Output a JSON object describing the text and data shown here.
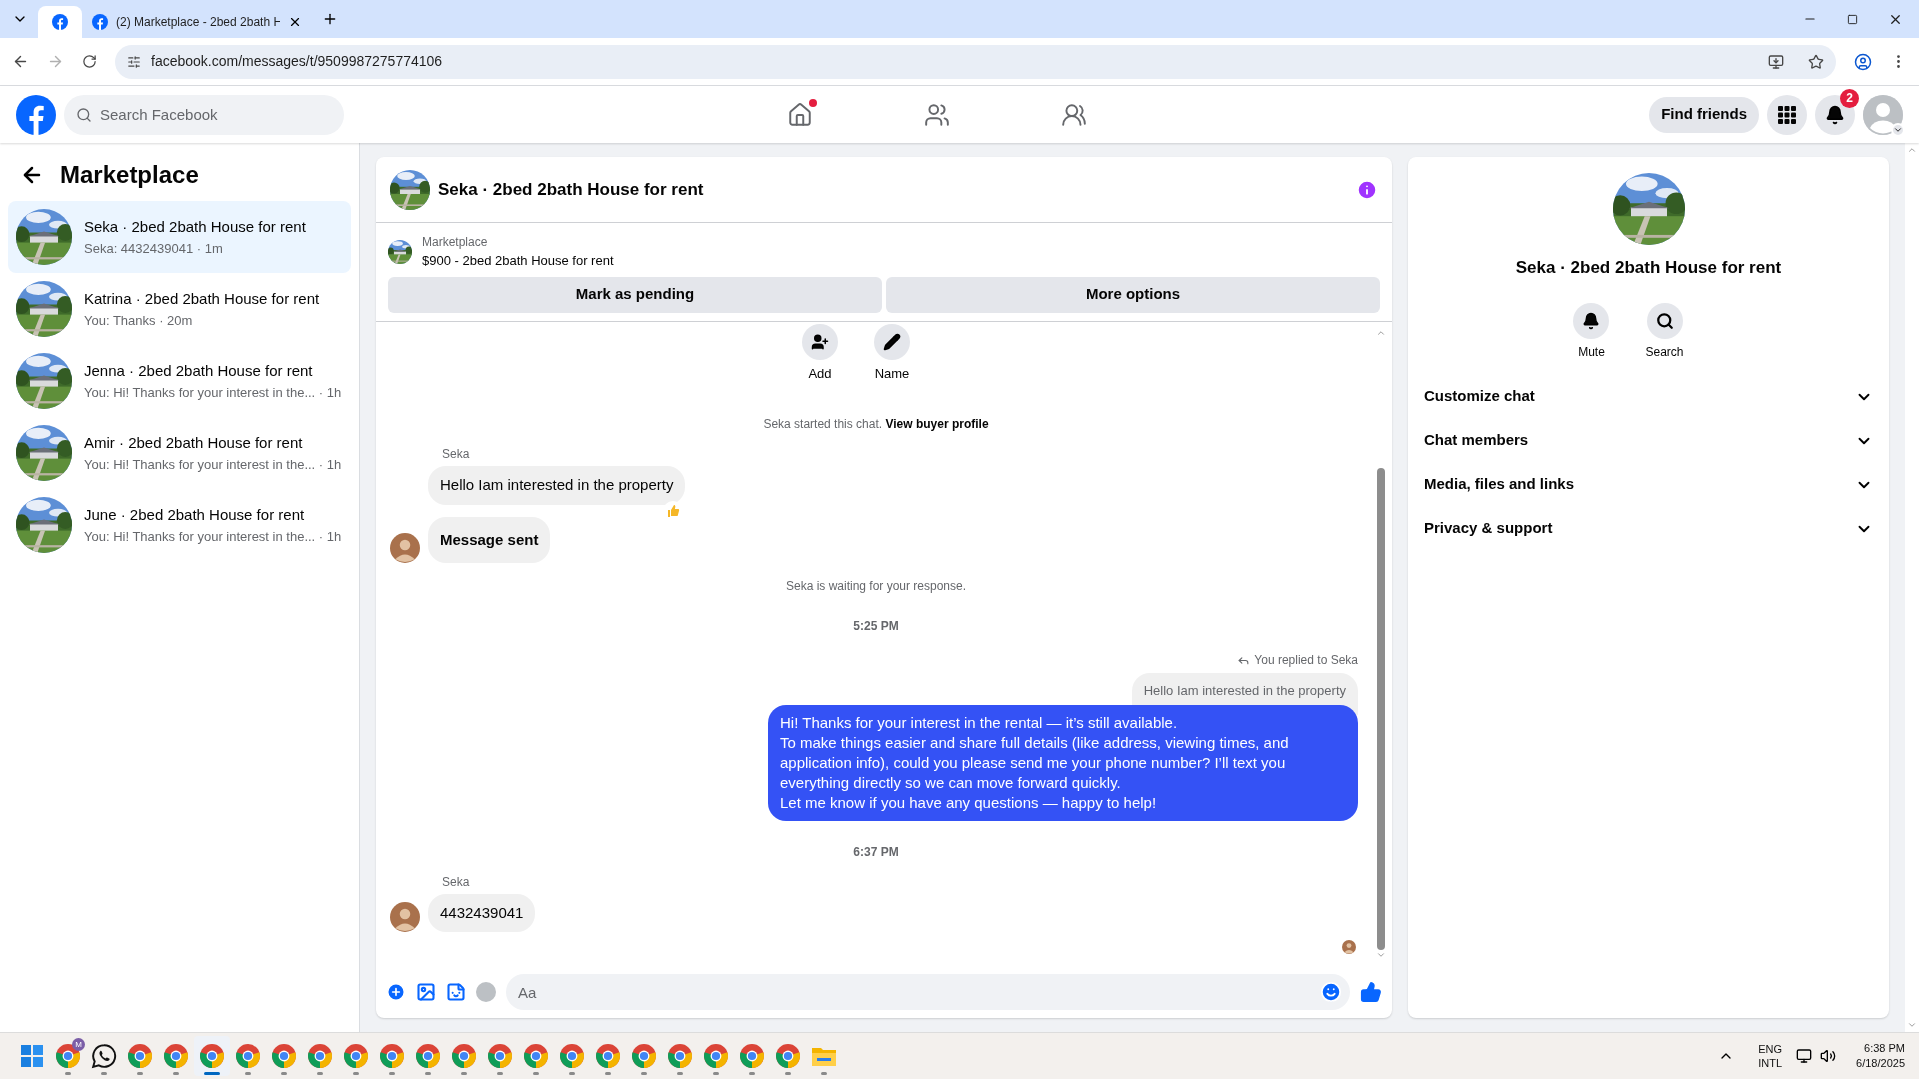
{
  "browser": {
    "tabs": [
      {
        "kind": "pinned",
        "selected": true
      },
      {
        "kind": "page",
        "title": "(2) Marketplace - 2bed 2bath H",
        "selected": false
      }
    ],
    "url": "facebook.com/messages/t/9509987275774106"
  },
  "header": {
    "search": {
      "placeholder": "Search Facebook"
    },
    "nav": [
      {
        "kind": "home",
        "dot": true
      },
      {
        "kind": "friends",
        "dot": false
      },
      {
        "kind": "groups",
        "dot": false
      }
    ],
    "find_friends": "Find friends",
    "notifications_badge": "2"
  },
  "sidebar": {
    "title": "Marketplace",
    "conversations": [
      {
        "title": "Seka · 2bed 2bath House for rent",
        "preview": "Seka: 4432439041 · 1m",
        "selected": true
      },
      {
        "title": "Katrina · 2bed 2bath House for rent",
        "preview": "You: Thanks · 20m",
        "selected": false
      },
      {
        "title": "Jenna · 2bed 2bath House for rent",
        "preview": "You: Hi! Thanks for your interest in the... · 1h",
        "selected": false
      },
      {
        "title": "Amir · 2bed 2bath House for rent",
        "preview": "You: Hi! Thanks for your interest in the... · 1h",
        "selected": false
      },
      {
        "title": "June · 2bed 2bath House for rent",
        "preview": "You: Hi! Thanks for your interest in the... · 1h",
        "selected": false
      }
    ]
  },
  "chat": {
    "title": "Seka · 2bed 2bath House for rent",
    "listing": {
      "label": "Marketplace",
      "title": "$900 - 2bed 2bath House for rent"
    },
    "actions": [
      "Mark as pending",
      "More options"
    ],
    "quick_actions": [
      {
        "kind": "add",
        "label": "Add"
      },
      {
        "kind": "name",
        "label": "Name"
      }
    ],
    "messages": [
      {
        "kind": "notice",
        "text": "Seka started this chat.",
        "link": "View buyer profile"
      },
      {
        "kind": "incoming",
        "sender": "Seka",
        "text": "Hello Iam interested in the property",
        "reaction": true,
        "avatar": false,
        "bold": false
      },
      {
        "kind": "incoming",
        "text": "Message sent",
        "reaction": false,
        "avatar": true,
        "bold": true
      },
      {
        "kind": "notice",
        "text": "Seka is waiting for your response."
      },
      {
        "kind": "time",
        "text": "5:25 PM"
      },
      {
        "kind": "outgoing",
        "reply_label": "You replied to Seka",
        "quoted": "Hello Iam interested in the property",
        "text": "Hi! Thanks for your interest in the rental — it’s still available.\nTo make things easier and share full details (like address, viewing times, and application info), could you please send me your phone number? I’ll text you everything directly so we can move forward quickly.\nLet me know if you have any questions — happy to help!"
      },
      {
        "kind": "time",
        "text": "6:37 PM"
      },
      {
        "kind": "incoming",
        "sender": "Seka",
        "text": "4432439041",
        "reaction": false,
        "avatar": true,
        "bold": false
      },
      {
        "kind": "seen"
      }
    ],
    "composer": {
      "placeholder": "Aa"
    }
  },
  "details": {
    "title": "Seka · 2bed 2bath House for rent",
    "actions": [
      {
        "kind": "mute",
        "label": "Mute"
      },
      {
        "kind": "search",
        "label": "Search"
      }
    ],
    "sections": [
      {
        "label": "Customize chat",
        "expanded": false
      },
      {
        "label": "Chat members",
        "expanded": false
      },
      {
        "label": "Media, files and links",
        "expanded": false
      },
      {
        "label": "Privacy & support",
        "expanded": false
      }
    ]
  },
  "taskbar": {
    "items": [
      {
        "kind": "start"
      },
      {
        "kind": "chrome",
        "badge": "M",
        "selected": false,
        "running": true
      },
      {
        "kind": "whatsapp",
        "selected": false,
        "running": true
      },
      {
        "kind": "chrome",
        "selected": false,
        "running": true
      },
      {
        "kind": "chrome",
        "selected": false,
        "running": true
      },
      {
        "kind": "chrome",
        "selected": true,
        "running": true
      },
      {
        "kind": "chrome",
        "selected": false,
        "running": true
      },
      {
        "kind": "chrome",
        "selected": false,
        "running": true
      },
      {
        "kind": "chrome",
        "selected": false,
        "running": true
      },
      {
        "kind": "chrome",
        "selected": false,
        "running": true
      },
      {
        "kind": "chrome",
        "selected": false,
        "running": true
      },
      {
        "kind": "chrome",
        "selected": false,
        "running": true
      },
      {
        "kind": "chrome",
        "selected": false,
        "running": true
      },
      {
        "kind": "chrome",
        "selected": false,
        "running": true
      },
      {
        "kind": "chrome",
        "selected": false,
        "running": true
      },
      {
        "kind": "chrome",
        "selected": false,
        "running": true
      },
      {
        "kind": "chrome",
        "selected": false,
        "running": true
      },
      {
        "kind": "chrome",
        "selected": false,
        "running": true
      },
      {
        "kind": "chrome",
        "selected": false,
        "running": true
      },
      {
        "kind": "chrome",
        "selected": false,
        "running": true
      },
      {
        "kind": "chrome",
        "selected": false,
        "running": true
      },
      {
        "kind": "chrome",
        "selected": false,
        "running": true
      },
      {
        "kind": "explorer",
        "selected": false,
        "running": true
      }
    ],
    "lang": "ENG",
    "layout": "INTL",
    "time": "6:38 PM",
    "date": "6/18/2025"
  }
}
